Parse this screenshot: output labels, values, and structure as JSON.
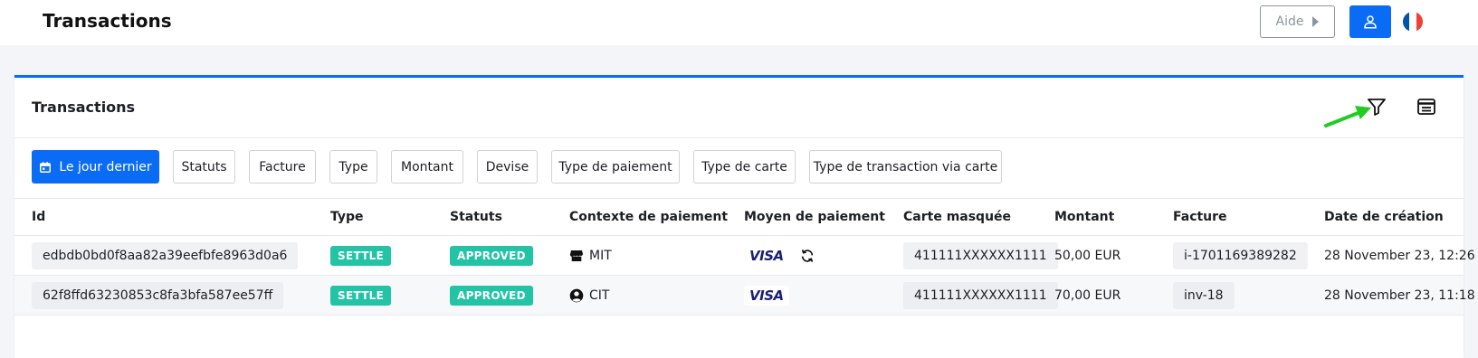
{
  "header": {
    "title": "Transactions",
    "help_label": "Aide",
    "flag_colors": [
      "#0055a4",
      "#ffffff",
      "#ef4135"
    ]
  },
  "card": {
    "title": "Transactions",
    "accent_color": "#0a6cf5"
  },
  "filters": {
    "date_label": "Le jour dernier",
    "items": [
      "Statuts",
      "Facture",
      "Type",
      "Montant",
      "Devise",
      "Type de paiement",
      "Type de carte",
      "Type de transaction via carte"
    ]
  },
  "table": {
    "columns": [
      "Id",
      "Type",
      "Statuts",
      "Contexte de paiement",
      "Moyen de paiement",
      "Carte masquée",
      "Montant",
      "Facture",
      "Date de création"
    ],
    "rows": [
      {
        "id": "edbdb0bd0f8aa82a39eefbfe8963d0a6",
        "type": "SETTLE",
        "status": "APPROVED",
        "context": "MIT",
        "context_icon": "store-icon",
        "payment_method": "VISA",
        "recurring_icon": "refresh-icon",
        "masked_card": "411111XXXXXX1111",
        "amount": "50,00 EUR",
        "invoice": "i-1701169389282",
        "created": "28 November 23, 12:26"
      },
      {
        "id": "62f8ffd63230853c8fa3bfa587ee57ff",
        "type": "SETTLE",
        "status": "APPROVED",
        "context": "CIT",
        "context_icon": "user-circle-icon",
        "payment_method": "VISA",
        "masked_card": "411111XXXXXX1111",
        "amount": "70,00 EUR",
        "invoice": "inv-18",
        "created": "28 November 23, 11:18"
      }
    ]
  },
  "colors": {
    "primary": "#0a6cf5",
    "badge": "#23c3a6",
    "annotation_arrow": "#22cc22"
  }
}
